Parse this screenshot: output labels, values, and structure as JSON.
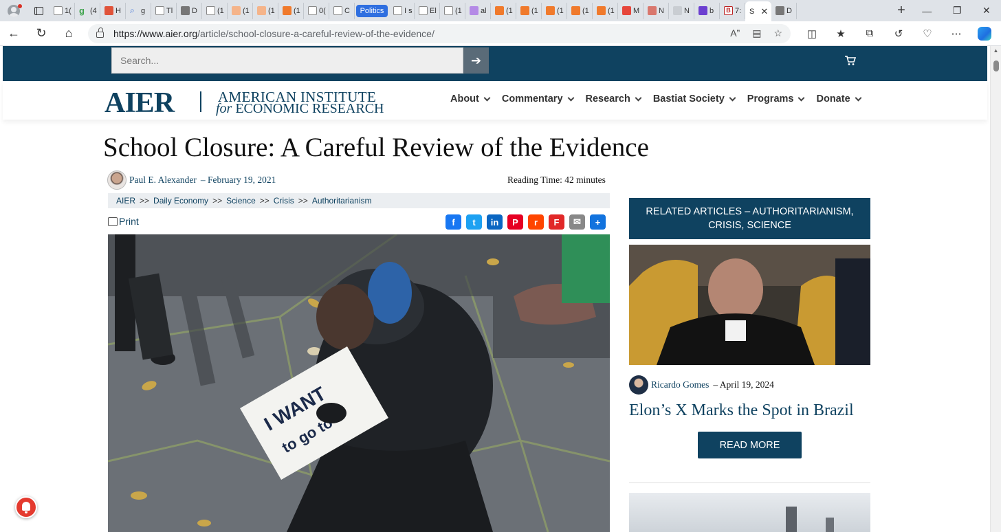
{
  "browser": {
    "tabs": [
      {
        "icon": "doc",
        "label": "1("
      },
      {
        "icon": "green",
        "label": "(4"
      },
      {
        "icon": "red",
        "label": "H"
      },
      {
        "icon": "mag",
        "label": "g"
      },
      {
        "icon": "doc",
        "label": "Tl"
      },
      {
        "icon": "dark",
        "label": "D"
      },
      {
        "icon": "doc",
        "label": "(1"
      },
      {
        "icon": "peach",
        "label": "(1"
      },
      {
        "icon": "peach",
        "label": "(1"
      },
      {
        "icon": "orange",
        "label": "(1"
      },
      {
        "icon": "doc",
        "label": "0("
      },
      {
        "icon": "doc",
        "label": "C"
      }
    ],
    "pill_tab": "Politics",
    "tabs2": [
      {
        "icon": "doc",
        "label": "I s"
      },
      {
        "icon": "doc",
        "label": "El"
      },
      {
        "icon": "doc",
        "label": "(1"
      },
      {
        "icon": "ltpurple",
        "label": "al"
      },
      {
        "icon": "orange",
        "label": "(1"
      },
      {
        "icon": "orange",
        "label": "(1"
      },
      {
        "icon": "orange",
        "label": "(1"
      },
      {
        "icon": "orange",
        "label": "(1"
      },
      {
        "icon": "orange",
        "label": "(1"
      },
      {
        "icon": "ytred",
        "label": "M"
      },
      {
        "icon": "rose",
        "label": "N"
      },
      {
        "icon": "gray",
        "label": "N"
      },
      {
        "icon": "purple",
        "label": "b"
      },
      {
        "icon": "bred",
        "label": "7:"
      }
    ],
    "active_tab": {
      "label": "S"
    },
    "last_tab": {
      "icon": "dark",
      "label": "D"
    },
    "url_host": "https://www.aier.org",
    "url_path": "/article/school-closure-a-careful-review-of-the-evidence/"
  },
  "site": {
    "search_placeholder": "Search...",
    "logo_abbr": "AIER",
    "logo_line1": "AMERICAN INSTITUTE",
    "logo_line2_italic": "for",
    "logo_line2": "ECONOMIC RESEARCH",
    "nav": [
      "About",
      "Commentary",
      "Research",
      "Bastiat Society",
      "Programs",
      "Donate"
    ]
  },
  "article": {
    "title": "School Closure: A Careful Review of the Evidence",
    "author": "Paul E. Alexander",
    "date": "February 19, 2021",
    "reading_time": "Reading Time: 42 minutes",
    "breadcrumbs": [
      "AIER",
      "Daily Economy",
      "Science",
      "Crisis",
      "Authoritarianism"
    ],
    "crumb_sep": ">>",
    "print_label": "Print",
    "share": [
      {
        "name": "facebook",
        "glyph": "f",
        "color": "#1877f2"
      },
      {
        "name": "twitter",
        "glyph": "t",
        "color": "#1da1f2"
      },
      {
        "name": "linkedin",
        "glyph": "in",
        "color": "#0a66c2"
      },
      {
        "name": "pinterest",
        "glyph": "P",
        "color": "#e60023"
      },
      {
        "name": "reddit",
        "glyph": "r",
        "color": "#ff4500"
      },
      {
        "name": "flipboard",
        "glyph": "F",
        "color": "#e12828"
      },
      {
        "name": "email",
        "glyph": "✉",
        "color": "#888888"
      },
      {
        "name": "share",
        "glyph": "+",
        "color": "#1273de"
      }
    ],
    "sign_text": [
      "I WANT",
      "to go to"
    ]
  },
  "sidebar": {
    "heading_line1": "RELATED ARTICLES – AUTHORITARIANISM,",
    "heading_line2": "CRISIS, SCIENCE",
    "author": "Ricardo Gomes",
    "date": "April 19, 2024",
    "title": "Elon’s X Marks the Spot in Brazil",
    "button": "READ MORE"
  }
}
